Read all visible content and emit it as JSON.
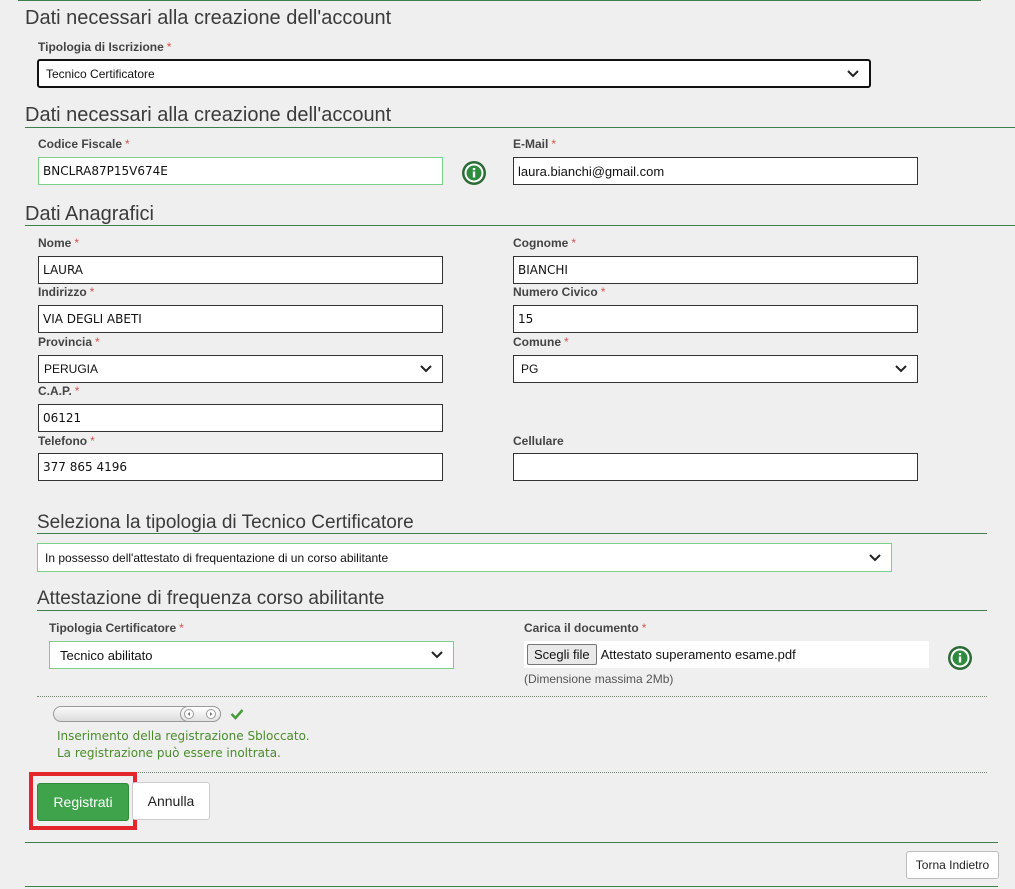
{
  "section1": {
    "title": "Dati necessari alla creazione dell'account",
    "tipologia_label": "Tipologia di Iscrizione",
    "tipologia_value": "Tecnico Certificatore"
  },
  "section2": {
    "title": "Dati necessari alla creazione dell'account",
    "codice_fiscale_label": "Codice Fiscale",
    "codice_fiscale_value": "BNCLRA87P15V674E",
    "email_label": "E-Mail",
    "email_value": "laura.bianchi@gmail.com"
  },
  "anagrafici": {
    "title": "Dati Anagrafici",
    "nome_label": "Nome",
    "nome_value": "LAURA",
    "cognome_label": "Cognome",
    "cognome_value": "BIANCHI",
    "indirizzo_label": "Indirizzo",
    "indirizzo_value": "VIA DEGLI ABETI",
    "civico_label": "Numero Civico",
    "civico_value": "15",
    "provincia_label": "Provincia",
    "provincia_value": "PERUGIA",
    "comune_label": "Comune",
    "comune_value": "PG",
    "cap_label": "C.A.P.",
    "cap_value": "06121",
    "telefono_label": "Telefono",
    "telefono_value": "377 865 4196",
    "cellulare_label": "Cellulare",
    "cellulare_value": ""
  },
  "tipologia_tecnico": {
    "title": "Seleziona la tipologia di Tecnico Certificatore",
    "value": "In possesso dell'attestato di frequentazione di un corso abilitante"
  },
  "attestazione": {
    "title": "Attestazione di frequenza corso abilitante",
    "tipologia_label": "Tipologia Certificatore",
    "tipologia_value": "Tecnico abilitato",
    "carica_label": "Carica il documento",
    "file_button": "Scegli file",
    "file_name": "Attestato superamento esame.pdf",
    "size_hint": "(Dimensione massima 2Mb)"
  },
  "unlock": {
    "line1": "Inserimento della registrazione Sbloccato.",
    "line2": "La registrazione può essere inoltrata."
  },
  "actions": {
    "registrati": "Registrati",
    "annulla": "Annulla",
    "torna_indietro": "Torna Indietro"
  },
  "required_marker": "*",
  "colors": {
    "accent_green": "#3ea34a",
    "highlight_red": "#e3262c",
    "rule_green": "#3f7f4a",
    "status_green": "#4a8b2c"
  },
  "icons": [
    "info-icon",
    "chevron-down-icon",
    "checkmark-icon",
    "slider-left-arrow-icon",
    "slider-right-arrow-icon"
  ]
}
